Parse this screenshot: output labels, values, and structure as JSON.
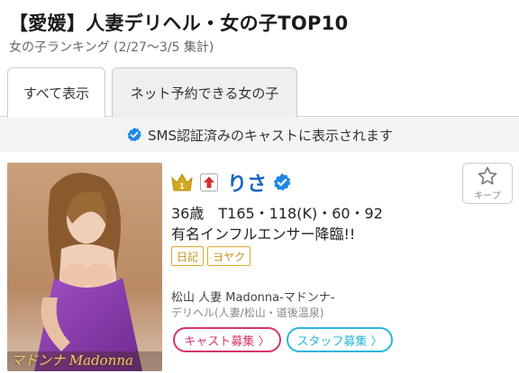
{
  "header": {
    "title": "【愛媛】人妻デリヘル・女の子TOP10",
    "subtitle": "女の子ランキング (2/27〜3/5 集計)"
  },
  "tabs": [
    {
      "label": "すべて表示",
      "active": true
    },
    {
      "label": "ネット予約できる女の子",
      "active": false
    }
  ],
  "sms_notice": "SMS認証済みのキャストに表示されます",
  "card": {
    "rank": "1",
    "name": "りさ",
    "stats": "36歳　T165・118(K)・60・92",
    "catch": "有名インフルエンサー降臨!!",
    "tags": [
      "日記",
      "ヨヤク"
    ],
    "shop": "松山 人妻 Madonna-マドンナ-",
    "shop_type": "デリヘル(人妻/松山・道後温泉)",
    "photo_caption": "マドンナ Madonna",
    "cast_button": "キャスト募集 〉",
    "staff_button": "スタッフ募集 〉",
    "keep_label": "キープ"
  },
  "colors": {
    "name": "#1565c0",
    "verify": "#1e88e5",
    "tag": "#e0a82e",
    "cast": "#d6336c",
    "staff": "#29b6d8"
  }
}
